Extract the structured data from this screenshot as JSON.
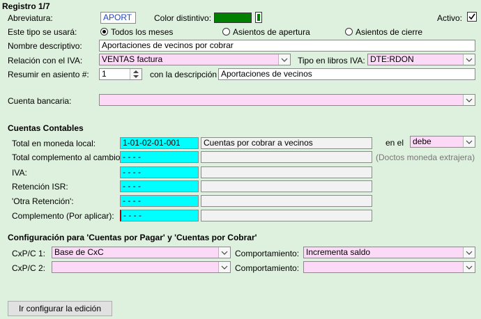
{
  "header": {
    "title": "Registro 1/7",
    "active_label": "Activo:"
  },
  "abbrev": {
    "label": "Abreviatura:",
    "value": "APORT"
  },
  "color": {
    "label": "Color distintivo:",
    "swatch": "#008000"
  },
  "usage": {
    "label": "Este tipo se usará:",
    "options": [
      {
        "label": "Todos los meses",
        "selected": true
      },
      {
        "label": "Asientos de apertura",
        "selected": false
      },
      {
        "label": "Asientos de cierre",
        "selected": false
      }
    ]
  },
  "descriptive_name": {
    "label": "Nombre descriptivo:",
    "value": "Aportaciones de vecinos por cobrar"
  },
  "iva_relation": {
    "label": "Relación con el IVA:",
    "value": "VENTAS factura"
  },
  "iva_book_type": {
    "label": "Tipo en libros IVA:",
    "value": "DTE:RDON"
  },
  "summarize": {
    "label": "Resumir en asiento #:",
    "value": "1",
    "desc_label": "con la descripción",
    "desc_value": "Aportaciones de vecinos"
  },
  "bank_account": {
    "label": "Cuenta bancaria:",
    "value": ""
  },
  "accounts": {
    "title": "Cuentas Contables",
    "rows": [
      {
        "label": "Total en moneda local:",
        "code": "1-01-02-01-001",
        "desc": "Cuentas por cobrar a vecinos"
      },
      {
        "label": "Total complemento al cambio:",
        "code": "- - - -",
        "desc": ""
      },
      {
        "label": "IVA:",
        "code": "- - - -",
        "desc": ""
      },
      {
        "label": "Retención ISR:",
        "code": "- - - -",
        "desc": ""
      },
      {
        "label": "'Otra Retención':",
        "code": "- - - -",
        "desc": ""
      },
      {
        "label": "Complemento (Por aplicar):",
        "code": "- - - -",
        "desc": ""
      }
    ],
    "side_label": "en el",
    "side_value": "debe",
    "foreign_note": "(Doctos moneda extrajera)"
  },
  "cxp": {
    "title": "Configuración para 'Cuentas por Pagar' y 'Cuentas por Cobrar'",
    "rows": [
      {
        "label": "CxP/C 1:",
        "value": "Base de CxC",
        "behavior_label": "Comportamiento:",
        "behavior_value": "Incrementa saldo"
      },
      {
        "label": "CxP/C 2:",
        "value": "",
        "behavior_label": "Comportamiento:",
        "behavior_value": ""
      }
    ]
  },
  "footer": {
    "edit_button": "Ir configurar la edición"
  }
}
